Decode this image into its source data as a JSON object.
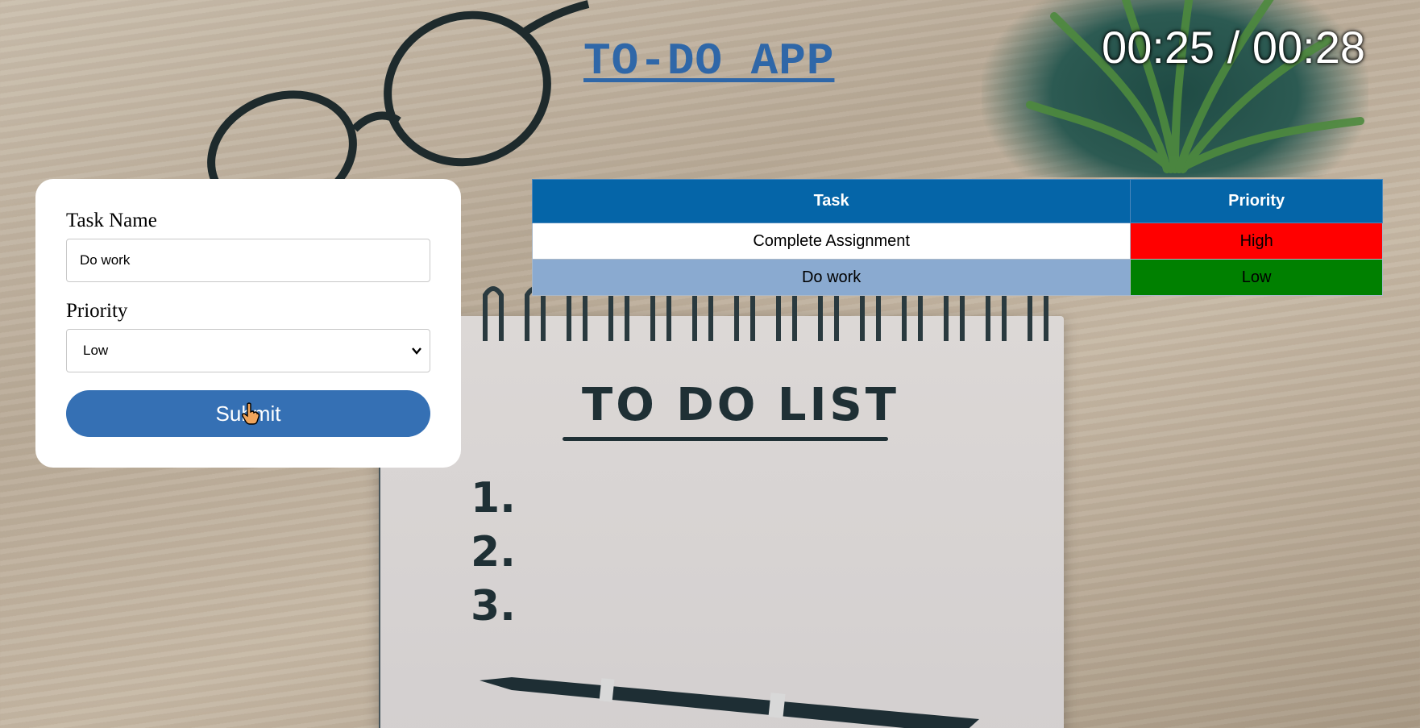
{
  "header": {
    "app_title": "TO-DO APP",
    "timer": "00:25 / 00:28"
  },
  "form": {
    "task_label": "Task Name",
    "task_value": "Do work",
    "priority_label": "Priority",
    "priority_selected": "Low",
    "submit_label": "Submit"
  },
  "table": {
    "headers": [
      "Task",
      "Priority"
    ],
    "rows": [
      {
        "task": "Complete Assignment",
        "priority": "High",
        "priority_color": "#ff0000"
      },
      {
        "task": "Do work",
        "priority": "Low",
        "priority_color": "#008000"
      }
    ]
  },
  "background_notepad": {
    "title": "TO DO LIST",
    "items": [
      "1.",
      "2.",
      "3."
    ]
  },
  "colors": {
    "accent": "#3570b4",
    "table_header": "#0565a8",
    "row_alt": "#8aaad0",
    "title": "#2f67a8"
  },
  "icons": {
    "select_arrow": "chevron-down-icon",
    "cursor": "hand-pointer-icon"
  }
}
